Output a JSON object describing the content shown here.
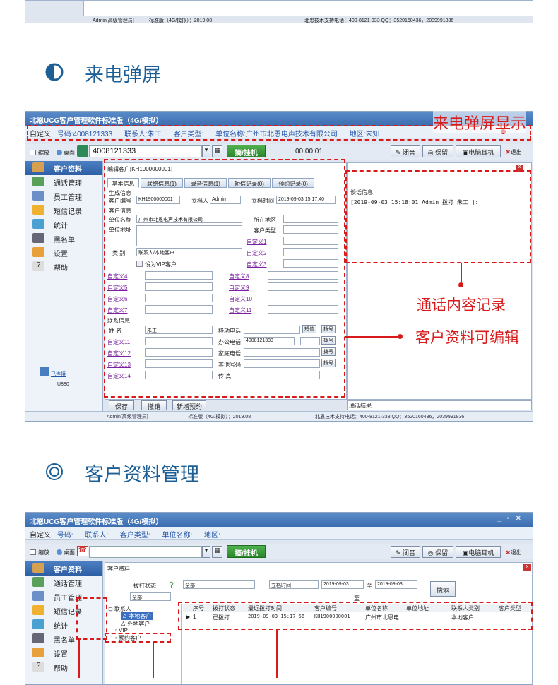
{
  "top_strip": {
    "status": "Admin[高级管理员]",
    "version": "标准版（4G/模拟）：2019.08",
    "support": "北恩技术支持电话：400-8121-333  QQ：3520160436，2039991836"
  },
  "section1": {
    "title": "来电弹屏",
    "icon": "half-circle-icon"
  },
  "section2": {
    "title": "客户资料管理",
    "icon": "double-circle-icon"
  },
  "accent_color": "#d81a1a",
  "window1": {
    "title": "北恩UCG客户管理软件标准版（4G/模拟）",
    "info": {
      "prefix": "自定义",
      "number": "号码:4008121333",
      "contact": "联系人:朱工",
      "ctype": "客户类型:",
      "company": "单位名称:广州市北恩电声技术有限公司",
      "region": "地区:未知"
    },
    "toolbar": {
      "mini": "缩放",
      "desktop": "桌面",
      "phone": "4008121333",
      "dial": "摘/挂机",
      "timer": "00:00:01",
      "mute": "闭音",
      "hold": "保留",
      "headset": "电脑耳机",
      "exit": "退出"
    },
    "edit_title": "编辑客户[KH1900000001]",
    "tabs": [
      "基本信息",
      "联络信息(1)",
      "录音信息(1)",
      "短信记录(0)",
      "预约记录(0)"
    ],
    "form": {
      "gen": "生成信息",
      "cust_no_l": "客户编号",
      "cust_no": "KH1900000001",
      "creator_l": "立档人",
      "creator": "Admin",
      "created_l": "立档时间",
      "created": "2019-09-03 15:17:40",
      "cust_info": "客户信息",
      "company_l": "单位名称",
      "company": "广州市北恩电声技术有限公司",
      "area_l": "所在地区",
      "addr_l": "单位地址",
      "type_l": "客户类型",
      "cat_l": "类   别",
      "cat": "联系人/本地客户",
      "vip": "设为VIP客户",
      "c1": "自定义1",
      "c2": "自定义2",
      "c3": "自定义3",
      "c4": "自定义4",
      "c5": "自定义5",
      "c6": "自定义6",
      "c7": "自定义7",
      "c8": "自定义8",
      "c9": "自定义9",
      "c10": "自定义10",
      "c11": "自定义11",
      "contact_info": "联系信息",
      "name_l": "姓   名",
      "name": "朱工",
      "mobile_l": "移动电话",
      "sms": "短信",
      "dial": "拨号",
      "c11b": "自定义11",
      "c12": "自定义12",
      "c13": "自定义13",
      "c14": "自定义14",
      "office_l": "办公电话",
      "office": "4008121333",
      "home_l": "家庭电话",
      "other_l": "其他号码",
      "fax_l": "传   真"
    },
    "call_info_label": "谈话信息",
    "call_log": "[2019-09-03 15:18:01 Admin 拨打 朱工 ]:",
    "result_label": "通话结果",
    "footer_btns": [
      "保存",
      "撤销",
      "新增预约"
    ],
    "sidebar": [
      "客户资料",
      "通话管理",
      "员工管理",
      "短信记录",
      "统计",
      "黑名单",
      "设置",
      "帮助"
    ],
    "device": {
      "state": "已连接",
      "model": "U880"
    },
    "status": "Admin[高级管理员]",
    "version": "标准版（4G/模拟）：2019.08",
    "support": "北恩技术支持电话：400-8121-333  QQ：3520160436，2039991836"
  },
  "annotations": {
    "popup": "来电弹屏显示",
    "calllog": "通话内容记录",
    "editable": "客户资料可编辑"
  },
  "window2": {
    "title": "北恩UCG客户管理软件标准版（4G/模拟）",
    "info": {
      "prefix": "自定义",
      "number": "号码:",
      "contact": "联系人:",
      "ctype": "客户类型:",
      "company": "单位名称:",
      "region": "地区:"
    },
    "tab_label": "客户资料",
    "filter": {
      "call_state_l": "拨打状态",
      "call_state": "全部",
      "all": "全部",
      "date_field": "立档时间",
      "date_from": "2019-09-03",
      "to": "至",
      "date_to": "2019-09-03",
      "search": "搜索",
      "to2": "至"
    },
    "tree": [
      "联系人",
      "本地客户",
      "外地客户",
      "VIP",
      "预约客户"
    ],
    "columns": [
      "序号",
      "拨打状态",
      "最近拨打时间",
      "客户编号",
      "单位名称",
      "单位地址",
      "联系人类别",
      "客户类型"
    ],
    "rows": [
      [
        "1",
        "已拨打",
        "2019-09-03 15:17:56",
        "KH1900000001",
        "广州市北恩电",
        "",
        "本地客户",
        ""
      ]
    ]
  }
}
